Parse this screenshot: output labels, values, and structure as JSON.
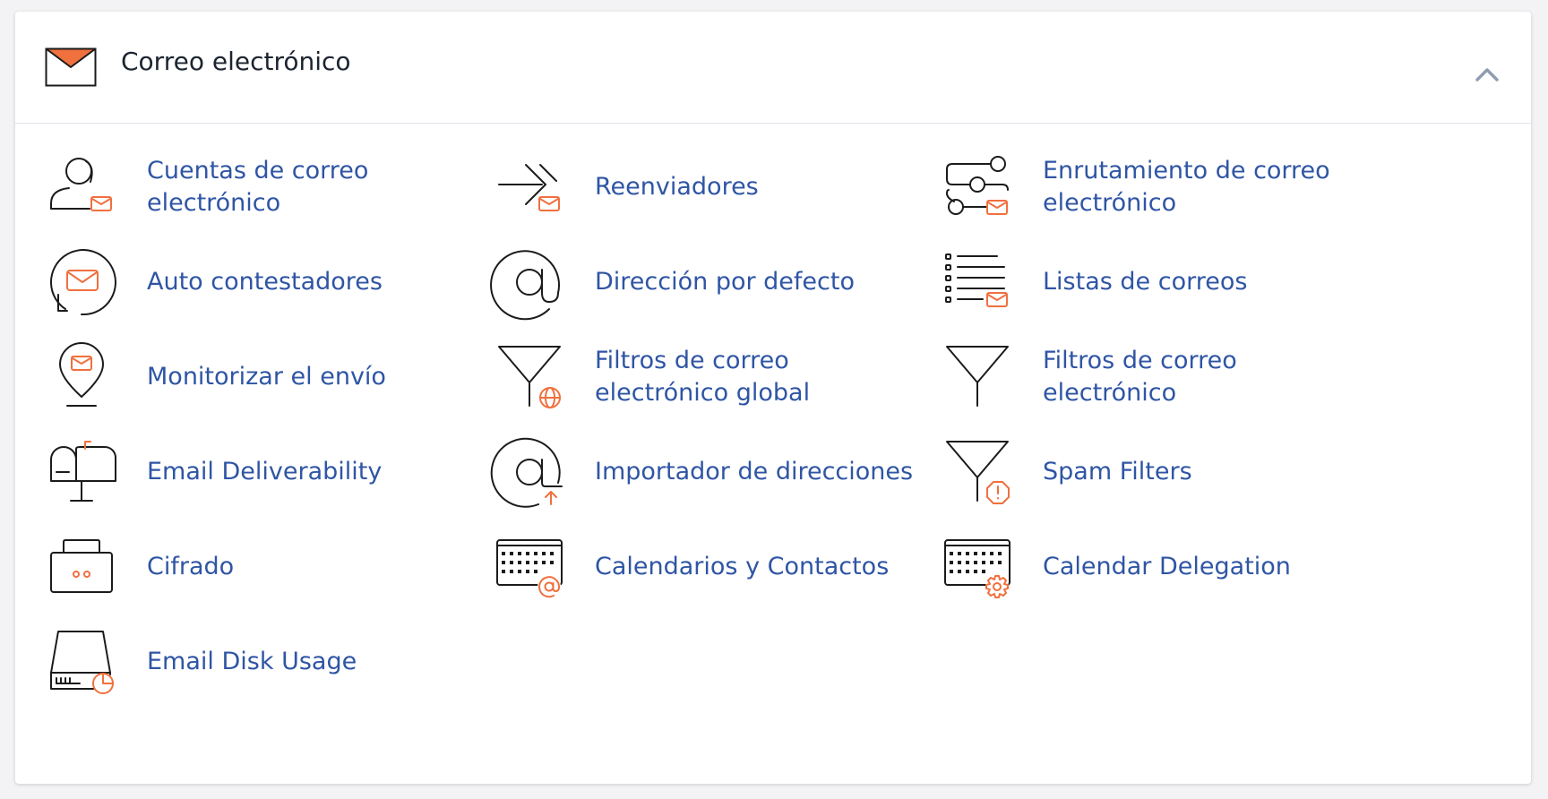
{
  "section": {
    "title": "Correo electrónico",
    "icon": "envelope-icon",
    "accent_color": "#f0703e",
    "link_color": "#2f55a4"
  },
  "items": [
    {
      "label": "Cuentas de correo electrónico",
      "icon": "email-accounts-icon"
    },
    {
      "label": "Reenviadores",
      "icon": "forwarders-icon"
    },
    {
      "label": "Enrutamiento de correo electrónico",
      "icon": "email-routing-icon"
    },
    {
      "label": "Auto contestadores",
      "icon": "autoresponders-icon"
    },
    {
      "label": "Dirección por defecto",
      "icon": "default-address-icon"
    },
    {
      "label": "Listas de correos",
      "icon": "mailing-lists-icon"
    },
    {
      "label": "Monitorizar el envío",
      "icon": "track-delivery-icon"
    },
    {
      "label": "Filtros de correo electrónico global",
      "icon": "global-email-filters-icon"
    },
    {
      "label": "Filtros de correo electrónico",
      "icon": "email-filters-icon"
    },
    {
      "label": "Email Deliverability",
      "icon": "email-deliverability-icon"
    },
    {
      "label": "Importador de direcciones",
      "icon": "address-importer-icon"
    },
    {
      "label": "Spam Filters",
      "icon": "spam-filters-icon"
    },
    {
      "label": "Cifrado",
      "icon": "encryption-icon"
    },
    {
      "label": "Calendarios y Contactos",
      "icon": "calendars-contacts-icon"
    },
    {
      "label": "Calendar Delegation",
      "icon": "calendar-delegation-icon"
    },
    {
      "label": "Email Disk Usage",
      "icon": "email-disk-usage-icon"
    }
  ]
}
